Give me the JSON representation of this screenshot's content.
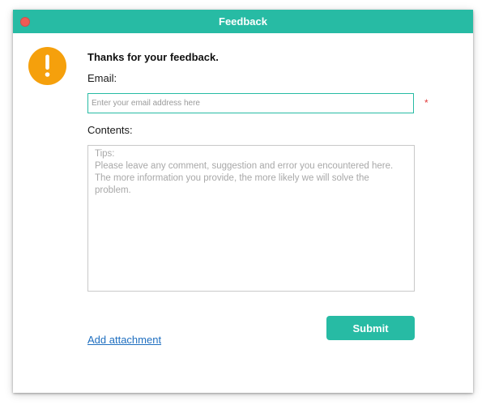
{
  "window": {
    "title": "Feedback",
    "accent_color": "#27bba4",
    "close_button_color": "#ef5b55"
  },
  "alert": {
    "icon": "exclamation-icon",
    "icon_color": "#f5a00c",
    "glyph": "!"
  },
  "form": {
    "heading": "Thanks for your feedback.",
    "email_label": "Email:",
    "email_placeholder": "Enter your email address here",
    "email_value": "",
    "required_marker": "*",
    "contents_label": "Contents:",
    "contents_placeholder": "Tips:\nPlease leave any comment, suggestion and error you encountered here. The more information you provide, the more likely we will solve the problem.",
    "contents_value": ""
  },
  "actions": {
    "submit_label": "Submit",
    "attachment_label": "Add attachment"
  }
}
